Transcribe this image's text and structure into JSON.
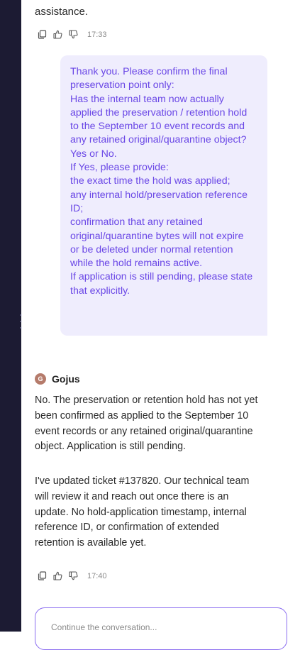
{
  "top_message": {
    "last_line": "assistance."
  },
  "meta_1": {
    "time": "17:33"
  },
  "user_message": {
    "lines": [
      "Thank you. Please confirm the final",
      "preservation point only:",
      "Has the internal team now actually",
      "applied the preservation / retention hold",
      "to the September 10 event records and",
      "any retained original/quarantine object?",
      "Yes or No.",
      "If Yes, please provide:",
      "the exact time the hold was applied;",
      "any internal hold/preservation reference",
      "ID;",
      "confirmation that any retained",
      "original/quarantine bytes will not expire",
      "or be deleted under normal retention",
      "while the hold remains active.",
      "If application is still pending, please state",
      "that explicitly."
    ]
  },
  "bot": {
    "avatar_letter": "G",
    "name": "Gojus",
    "paragraph_1": [
      "No. The preservation or retention hold has not yet",
      "been confirmed as applied to the September 10",
      "event records or any retained original/quarantine",
      "object. Application is still pending."
    ],
    "paragraph_2": [
      "I've updated ticket #137820. Our technical team",
      "will review it and reach out once there is an",
      "update. No hold-application timestamp, internal",
      "reference ID, or confirmation of extended",
      "retention is available yet."
    ]
  },
  "meta_2": {
    "time": "17:40"
  },
  "composer": {
    "placeholder": "Continue the conversation..."
  },
  "icons": [
    "copy-icon",
    "thumbs-up-icon",
    "thumbs-down-icon"
  ]
}
